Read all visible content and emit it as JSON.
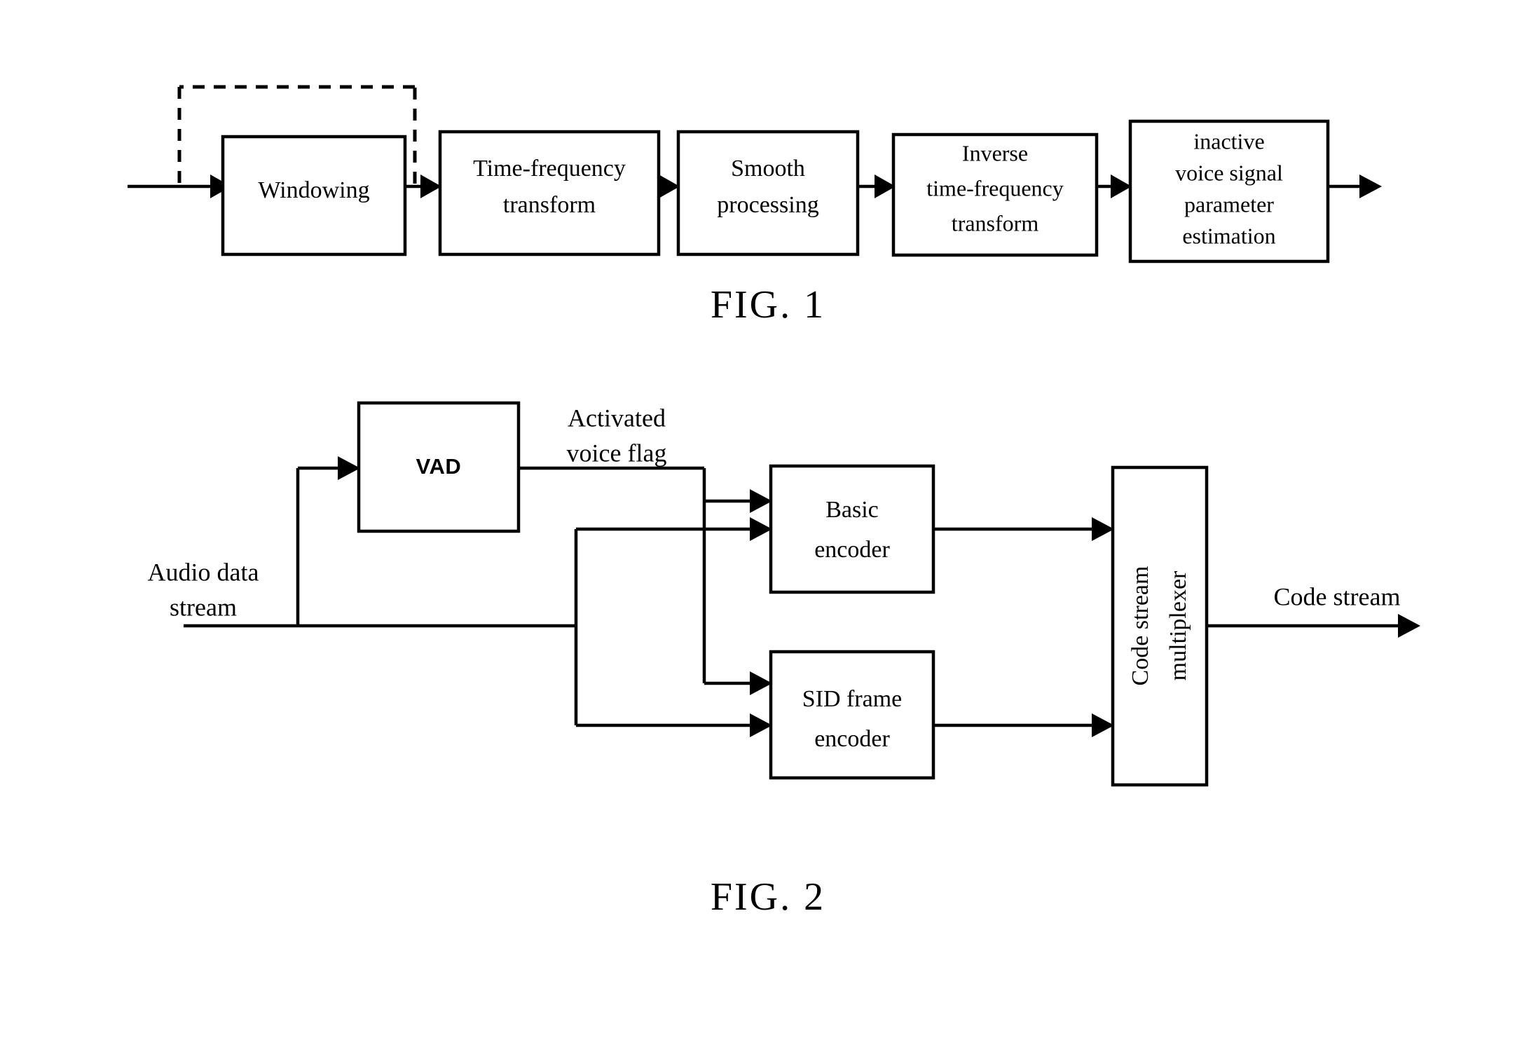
{
  "figures": [
    {
      "id": "fig1",
      "caption": "FIG. 1",
      "blocks": [
        {
          "id": "windowing",
          "lines": [
            "Windowing"
          ]
        },
        {
          "id": "tf_transform",
          "lines": [
            "Time-frequency",
            "transform"
          ]
        },
        {
          "id": "smooth",
          "lines": [
            "Smooth",
            "processing"
          ]
        },
        {
          "id": "inv_tf_transform",
          "lines": [
            "Inverse",
            "time-frequency",
            "transform"
          ]
        },
        {
          "id": "param_est",
          "lines": [
            "inactive",
            "voice signal",
            "parameter",
            "estimation"
          ]
        }
      ],
      "edges": [
        {
          "id": "input-arrow",
          "style": "solid",
          "label": ""
        },
        {
          "id": "win-to-tf",
          "style": "solid",
          "label": ""
        },
        {
          "id": "tf-to-smooth",
          "style": "solid",
          "label": ""
        },
        {
          "id": "smooth-to-invtf",
          "style": "solid",
          "label": ""
        },
        {
          "id": "invtf-to-param",
          "style": "solid",
          "label": ""
        },
        {
          "id": "output-arrow",
          "style": "solid",
          "label": ""
        },
        {
          "id": "feedback-loop",
          "style": "dashed",
          "label": ""
        }
      ]
    },
    {
      "id": "fig2",
      "caption": "FIG. 2",
      "blocks": [
        {
          "id": "vad",
          "lines": [
            "VAD"
          ]
        },
        {
          "id": "basic_encoder",
          "lines": [
            "Basic",
            "encoder"
          ]
        },
        {
          "id": "sid_encoder",
          "lines": [
            "SID frame",
            "encoder"
          ]
        },
        {
          "id": "code_stream_mux",
          "lines": [
            "Code stream",
            "multiplexer"
          ]
        }
      ],
      "labels": [
        {
          "id": "audio_in",
          "lines": [
            "Audio data",
            "stream"
          ]
        },
        {
          "id": "vad_flag",
          "lines": [
            "Activated",
            "voice flag"
          ]
        },
        {
          "id": "code_stream",
          "lines": [
            "Code stream"
          ]
        }
      ],
      "edges": [
        {
          "id": "audio-to-vad",
          "style": "solid"
        },
        {
          "id": "vad-to-basic",
          "style": "solid"
        },
        {
          "id": "vad-to-sid",
          "style": "solid"
        },
        {
          "id": "audio-to-basic",
          "style": "solid"
        },
        {
          "id": "audio-to-sid",
          "style": "solid"
        },
        {
          "id": "basic-to-mux",
          "style": "solid"
        },
        {
          "id": "sid-to-mux",
          "style": "solid"
        },
        {
          "id": "mux-to-codestream",
          "style": "solid"
        }
      ]
    }
  ],
  "colors": {
    "stroke": "#000000",
    "fill": "#ffffff",
    "text": "#000000"
  }
}
